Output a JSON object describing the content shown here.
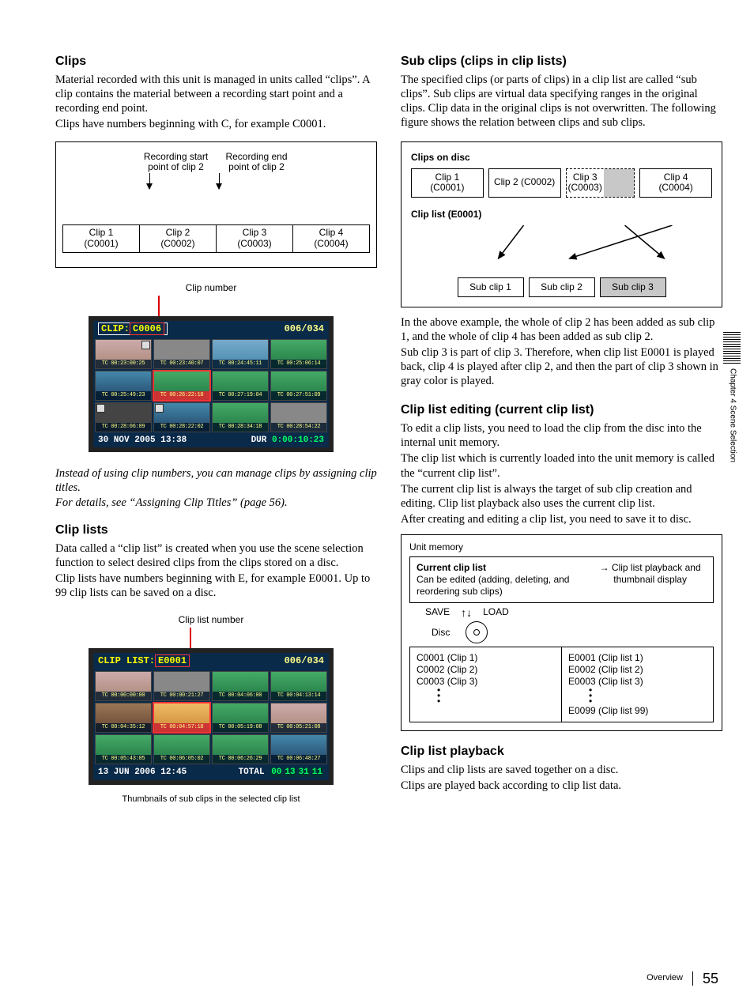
{
  "left": {
    "h_clips": "Clips",
    "p1": "Material recorded with this unit is managed in units called “clips”. A clip contains the material between a recording start point and a recording end point.",
    "p2": "Clips have numbers beginning with C, for example C0001.",
    "diag1": {
      "rec_start": "Recording start point of clip 2",
      "rec_end": "Recording end point of clip 2",
      "c1a": "Clip 1",
      "c1b": "(C0001)",
      "c2a": "Clip 2",
      "c2b": "(C0002)",
      "c3a": "Clip 3",
      "c3b": "(C0003)",
      "c4a": "Clip 4",
      "c4b": "(C0004)"
    },
    "clip_number_label": "Clip number",
    "screen1": {
      "tl_prefix": "CLIP:",
      "tl_id": "C0006",
      "tr": "006/034",
      "tcs": [
        "TC 00:23:00:25",
        "TC 00:23:40:07",
        "TC 00:24:45:11",
        "TC 00:25:06:14",
        "TC 00:25:49:23",
        "TC 00:26:22:10",
        "TC 00:27:19:04",
        "TC 00:27:51:09",
        "TC 00:28:06:09",
        "TC 00:28:22:02",
        "TC 00:28:34:18",
        "TC 00:28:54:22"
      ],
      "bl": "30 NOV 2005 13:38",
      "br_l": "DUR",
      "br_v": "0:00:10:23"
    },
    "note1a": "Instead of using clip numbers, you can manage clips by assigning clip titles.",
    "note1b": "For details, see “Assigning Clip Titles” (page 56).",
    "h_lists": "Clip lists",
    "p3": "Data called a “clip list” is created when you use the scene selection function to select desired clips from the clips stored on a disc.",
    "p4": "Clip lists have numbers beginning with E, for example E0001. Up to 99 clip lists can be saved on a disc.",
    "clip_list_number_label": "Clip list number",
    "screen2": {
      "tl_prefix": "CLIP LIST:",
      "tl_id": "E0001",
      "tr": "006/034",
      "tcs": [
        "TC 00:00:00:00",
        "TC 00:00:21:27",
        "TC 00:04:06:00",
        "TC 00:04:13:14",
        "TC 00:04:35:12",
        "TC 00:04:57:10",
        "TC 00:05:19:08",
        "TC 00:05:21:08",
        "TC 00:05:43:05",
        "TC 00:06:05:02",
        "TC 00:06:26:29",
        "TC 00:06:48:27"
      ],
      "bl": "13 JUN 2006 12:45",
      "br_l": "TOTAL",
      "tot": [
        "00",
        "13",
        "31",
        "11"
      ]
    },
    "caption2": "Thumbnails of sub clips in the selected clip list"
  },
  "right": {
    "h_sub": "Sub clips (clips in clip lists)",
    "p1": "The specified clips (or parts of clips) in a clip list are called “sub clips”. Sub clips are virtual data specifying ranges in the original clips. Clip data in the original clips is not overwritten. The following figure shows the relation between clips and sub clips.",
    "diag2": {
      "h1": "Clips on disc",
      "c1a": "Clip 1",
      "c1b": "(C0001)",
      "c2": "Clip 2 (C0002)",
      "c3a": "Clip 3",
      "c3b": "(C0003)",
      "c4a": "Clip 4",
      "c4b": "(C0004)",
      "h2": "Clip list (E0001)",
      "s1": "Sub clip 1",
      "s2": "Sub clip 2",
      "s3": "Sub clip 3"
    },
    "p2": "In the above example, the whole of clip 2 has been added as sub clip 1, and the whole of clip 4 has been added as sub clip 2.",
    "p3": "Sub clip 3 is part of clip 3. Therefore, when clip list E0001 is played back, clip 4 is played after clip 2, and then the part of clip 3 shown in gray color is played.",
    "h_edit": "Clip list editing (current clip list)",
    "p4": "To edit a clip lists, you need to load the clip from the disc into the internal unit memory.",
    "p5": "The clip list which is currently loaded into the unit memory is called the “current clip list”.",
    "p6": "The current clip list is always the target of sub clip creation and editing. Clip list playback also uses the current clip list.",
    "p7": "After creating and editing a clip list, you need to save it to disc.",
    "diag3": {
      "unit": "Unit memory",
      "ccl": "Current clip list",
      "ccl2": "Can be edited (adding, deleting, and reordering sub clips)",
      "arrow": "→",
      "play": "Clip list playback and thumbnail display",
      "save": "SAVE",
      "load": "LOAD",
      "disc": "Disc",
      "cl": [
        "C0001 (Clip 1)",
        "C0002 (Clip 2)",
        "C0003 (Clip 3)"
      ],
      "el": [
        "E0001 (Clip list 1)",
        "E0002 (Clip list 2)",
        "E0003 (Clip list 3)"
      ],
      "e99": "E0099 (Clip list 99)"
    },
    "h_play": "Clip list playback",
    "p8": "Clips and clip lists are saved together on a disc.",
    "p9": "Clips are played back according to clip list data."
  },
  "side": "Chapter 4  Scene Selection",
  "footer": {
    "sect": "Overview",
    "page": "55"
  }
}
